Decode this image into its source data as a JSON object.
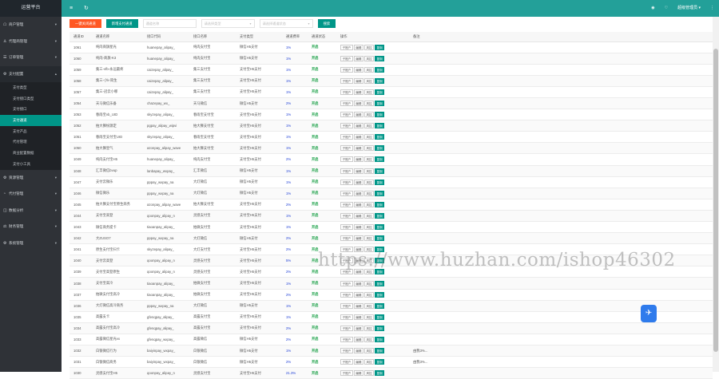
{
  "app": {
    "title": "运营平台"
  },
  "topbar": {
    "menu_icon": "≡",
    "refresh_icon": "↻",
    "user": "超级管理员 ▾",
    "more": "⋮"
  },
  "sidebar": {
    "items": [
      {
        "label": "商户管理",
        "icon": "☖"
      },
      {
        "label": "代理商管理",
        "icon": "♙"
      },
      {
        "label": "订单管理",
        "icon": "☰"
      },
      {
        "label": "支付配置",
        "icon": "⚙",
        "open": true
      },
      {
        "label": "资源管理",
        "icon": "⚙"
      },
      {
        "label": "代付管理",
        "icon": "◔"
      },
      {
        "label": "数据分析",
        "icon": "◫"
      },
      {
        "label": "财务管理",
        "icon": "⚖"
      },
      {
        "label": "系统管理",
        "icon": "⚙"
      }
    ],
    "sub_items": [
      "支付类型",
      "支付接口类型",
      "支付接口",
      "支付通道",
      "支付产品",
      "代付管理",
      "商业配置数据",
      "支付小工具"
    ],
    "active_sub": 3
  },
  "filters": {
    "clear_btn": "一键关闭通道",
    "add_btn": "新增支付通道",
    "name_placeholder": "通道名称",
    "type_placeholder": "请选择类型",
    "iface_placeholder": "请选择通道状态",
    "search_btn": "搜索"
  },
  "table": {
    "headers": [
      "通道ID",
      "通道名称",
      "接口代码",
      "接口名称",
      "支付类型",
      "通道费率",
      "通道状态",
      "操作",
      "备注"
    ],
    "ops": [
      "子账户",
      "编辑",
      "风控",
      "复制"
    ],
    "rows": [
      [
        "1061",
        "纯肉商旗星光",
        "huanepay_alipay_",
        "纯肉支付宝",
        "微信H5支付",
        "1%",
        "开启",
        ""
      ],
      [
        "1060",
        "纯肉-商旗-K3",
        "huanepay_alipay_",
        "纯肉支付宝",
        "微信H5支付",
        "1%",
        "开启",
        ""
      ],
      [
        "1059",
        "集三-vfb-永远最疼",
        "caizepay_alipay_",
        "集三支付宝",
        "支付宝H5支付",
        "1%",
        "开启",
        ""
      ],
      [
        "1058",
        "集三-小k-简生",
        "caizepay_alipay_",
        "集三支付宝",
        "支付宝H5支付",
        "1%",
        "开启",
        ""
      ],
      [
        "1057",
        "集三-冠云小哪",
        "caizepay_alipay_",
        "集三支付宝",
        "支付宝H5支付",
        "1%",
        "开启",
        ""
      ],
      [
        "1054",
        "天马微信乐备",
        "chazepay_wx_",
        "天马微信",
        "微信H5支付",
        "2%",
        "开启",
        ""
      ],
      [
        "1053",
        "春雨宝vb_UID",
        "skyzepay_alipay_",
        "春雨宝支付宝",
        "支付宝H5支付",
        "1%",
        "开启",
        ""
      ],
      [
        "1052",
        "拍大狮纷源定",
        "pgpay_alipay_wipvi",
        "拍大狮支付宝",
        "支付宝H5支付",
        "1%",
        "开启",
        ""
      ],
      [
        "1051",
        "春雨宝支付宝UID",
        "skyzepay_alipay_",
        "春雨宝支付宝",
        "支付宝H5支付",
        "1%",
        "开启",
        ""
      ],
      [
        "1050",
        "拍大狮皇气",
        "azonpay_alipay_wave",
        "拍大狮支付宝",
        "支付宝H5支付",
        "1%",
        "开启",
        ""
      ],
      [
        "1049",
        "纯肉支付宝H5",
        "huanepay_alipay_",
        "纯肉支付宝",
        "支付宝H5支付",
        "2%",
        "开启",
        ""
      ],
      [
        "1048",
        "汇丰微信bvup",
        "lanbapay_wxpay_",
        "汇丰微信",
        "微信H5支付",
        "1%",
        "开启",
        ""
      ],
      [
        "1047",
        "支付云微乐",
        "pppay_wxpay_na",
        "大灯微信",
        "微信H5支付",
        "1%",
        "开启",
        ""
      ],
      [
        "1046",
        "微信微乐",
        "pppay_wxpay_na",
        "大灯微信",
        "微信H5支付",
        "1%",
        "开启",
        ""
      ],
      [
        "1045",
        "拍大狮支付宝原生商务",
        "azonpay_alipay_wave",
        "拍大狮支付宝",
        "支付宝H5支付",
        "2%",
        "开启",
        ""
      ],
      [
        "1044",
        "支付宝高登",
        "qoonpay_alipay_n",
        "灵感支付宝",
        "支付宝H5支付",
        "1%",
        "开启",
        ""
      ],
      [
        "1043",
        "微信商务提卡",
        "tiaoanpay_alipay_",
        "拍微支付宝",
        "支付宝H5支付",
        "1%",
        "开启",
        ""
      ],
      [
        "1042",
        "大ZUSO7",
        "pppay_wxpay_na",
        "大灯微信",
        "微信H5支付",
        "2%",
        "开启",
        ""
      ],
      [
        "1041",
        "原生支付宝扫卡",
        "skyzepay_alipay_",
        "大灯支付宝",
        "支付宝H5支付",
        "2%",
        "开启",
        ""
      ],
      [
        "1040",
        "支付云高登",
        "qoonpay_alipay_n",
        "灵感支付宝",
        "支付宝H5支付",
        "5%",
        "开启",
        ""
      ],
      [
        "1039",
        "支付宝高登原生",
        "qoonpay_alipay_n",
        "灵感支付宝",
        "支付宝H5支付",
        "2%",
        "开启",
        ""
      ],
      [
        "1038",
        "支付宝高冷",
        "tiaoanpay_alipay_",
        "拍微支付宝",
        "支付宝H5支付",
        "1%",
        "开启",
        ""
      ],
      [
        "1037",
        "拍微支付宝高冷",
        "tiaoanpay_alipay_",
        "拍微支付宝",
        "支付宝H5支付",
        "2%",
        "开启",
        ""
      ],
      [
        "1036",
        "大灯微信高冷商务",
        "pppay_wxpay_na",
        "大灯微信",
        "微信H5支付",
        "1%",
        "开启",
        ""
      ],
      [
        "1035",
        "高露支卡",
        "gfenqpay_alipay_",
        "高露支付宝",
        "支付宝H5支付",
        "1%",
        "开启",
        ""
      ],
      [
        "1034",
        "高露支付宝高冷",
        "gfenqpay_alipay_",
        "高露支付宝",
        "支付宝H5支付",
        "2%",
        "开启",
        ""
      ],
      [
        "1033",
        "高露微信星光vx",
        "gfenqpay_wxpay_",
        "高露微信",
        "微信H5支付",
        "2%",
        "开启",
        ""
      ],
      [
        "1032",
        "白银微信行为",
        "baiyinpay_wxpay_",
        "白银微信",
        "微信H5支付",
        "1%",
        "开启",
        "由我3%..."
      ],
      [
        "1031",
        "白银微信商务",
        "baiyinpay_wxpay_",
        "白银微信",
        "微信H5支付",
        "2%",
        "开启",
        "由我3%..."
      ],
      [
        "1030",
        "灵感支付宝H5",
        "qoonpay_alipay_n",
        "灵感支付宝",
        "支付宝H5支付",
        "21.3%",
        "开启",
        ""
      ]
    ]
  },
  "watermark": "https://www.huzhan.com/ishop46302",
  "float_icon": "✈"
}
